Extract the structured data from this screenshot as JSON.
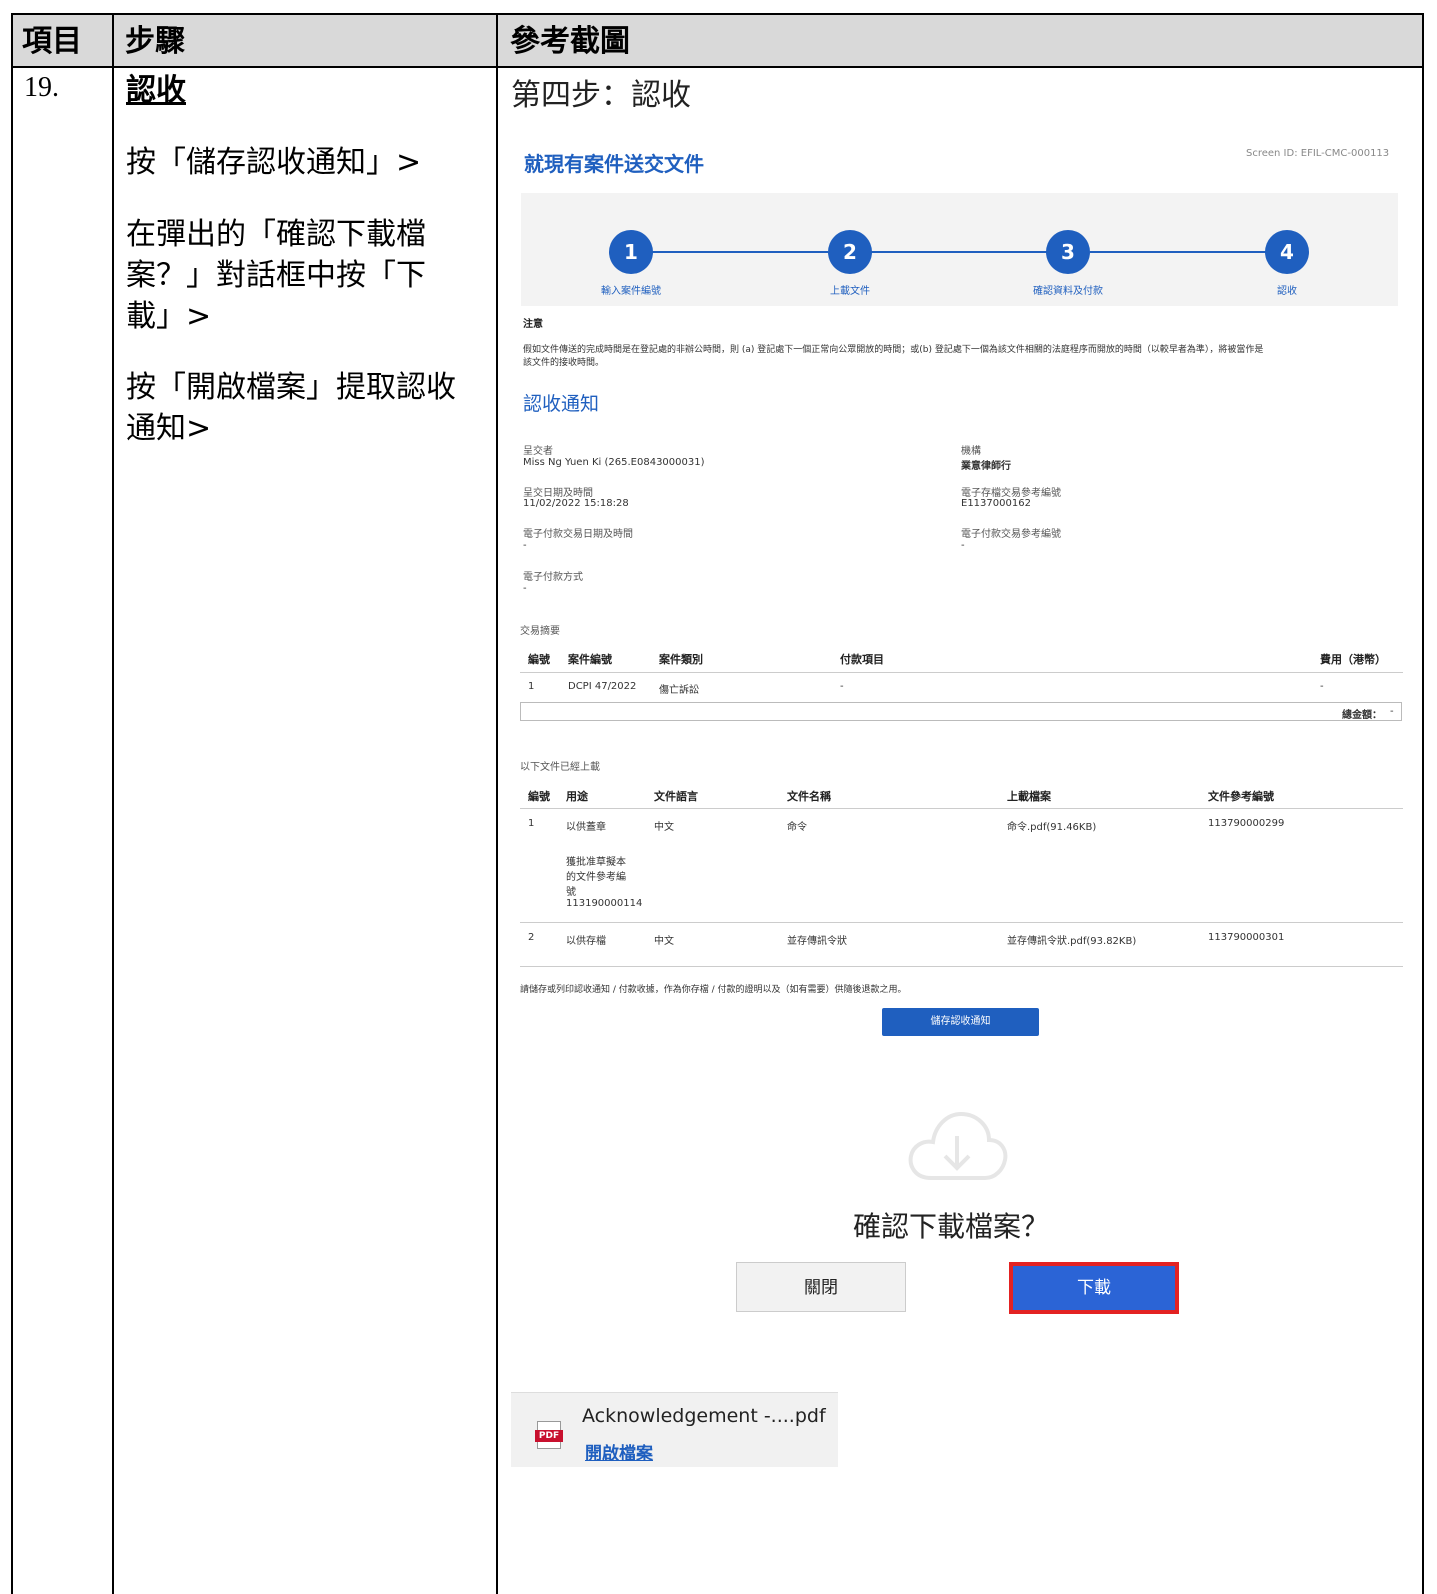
{
  "header": {
    "col1": "項目",
    "col2": "步驟",
    "col3": "參考截圖"
  },
  "row": {
    "item_no": "19.",
    "step_title": "認收",
    "step_1": "按「儲存認收通知」>",
    "step_2": "在彈出的「確認下載檔案？」對話框中按「下載」>",
    "step_3": "按「開啟檔案」提取認收通知>",
    "screenshot_caption": "第四步：認收"
  },
  "screen": {
    "title": "就現有案件送交文件",
    "screen_id": "Screen ID: EFIL-CMC-000113",
    "steps": [
      {
        "num": "1",
        "label": "輸入案件編號"
      },
      {
        "num": "2",
        "label": "上載文件"
      },
      {
        "num": "3",
        "label": "確認資料及付款"
      },
      {
        "num": "4",
        "label": "認收"
      }
    ],
    "note_label": "注意",
    "note_text_1": "假如文件傳送的完成時間是在登記處的非辦公時間，則 (a) 登記處下一個正常向公眾開放的時間；或(b) 登記處下一個為該文件相關的法庭程序而開放的時間（以較早者為準），將被當作是",
    "note_text_2": "該文件的接收時間。",
    "ack_heading": "認收通知",
    "submitter_label": "呈交者",
    "submitter_value": "Miss Ng Yuen Ki (265.E0843000031)",
    "org_label": "機構",
    "org_value": "業意律師行",
    "submit_dt_label": "呈交日期及時間",
    "submit_dt_value": "11/02/2022 15:18:28",
    "efile_ref_label": "電子存檔交易參考編號",
    "efile_ref_value": "E1137000162",
    "epay_dt_label": "電子付款交易日期及時間",
    "epay_dt_value": "-",
    "epay_ref_label": "電子付款交易參考編號",
    "epay_ref_value": "-",
    "epay_method_label": "電子付款方式",
    "epay_method_value": "-",
    "txn_summary_label": "交易摘要",
    "txn_headers": [
      "編號",
      "案件編號",
      "案件類別",
      "付款項目",
      "費用（港幣）"
    ],
    "txn_row": [
      "1",
      "DCPI 47/2022",
      "傷亡訴訟",
      "-",
      "-"
    ],
    "total_label": "總金額：",
    "total_value": "-",
    "uploaded_label": "以下文件已經上載",
    "doc_headers": [
      "編號",
      "用途",
      "文件語言",
      "文件名稱",
      "上載檔案",
      "文件參考編號"
    ],
    "doc_row1": [
      "1",
      "以供蓋章",
      "中文",
      "命令",
      "命令.pdf(91.46KB)",
      "113790000299"
    ],
    "doc_row1_extra": [
      "獲批准草擬本",
      "的文件參考編",
      "號",
      "113190000114"
    ],
    "doc_row2": [
      "2",
      "以供存檔",
      "中文",
      "並存傳訊令狀",
      "並存傳訊令狀.pdf(93.82KB)",
      "113790000301"
    ],
    "save_note": "請儲存或列印認收通知 / 付款收據，作為你存檔 / 付款的證明以及（如有需要）供隨後退款之用。",
    "save_button": "儲存認收通知"
  },
  "dialog": {
    "title": "確認下載檔案？",
    "close_button": "關閉",
    "download_button": "下載"
  },
  "download_bar": {
    "filename": "Acknowledgement -....pdf",
    "open_link": "開啟檔案",
    "pdf_badge": "PDF"
  },
  "colors": {
    "accent": "#1f5fbf",
    "highlight": "#e32222",
    "header_bg": "#d9d9d9"
  }
}
